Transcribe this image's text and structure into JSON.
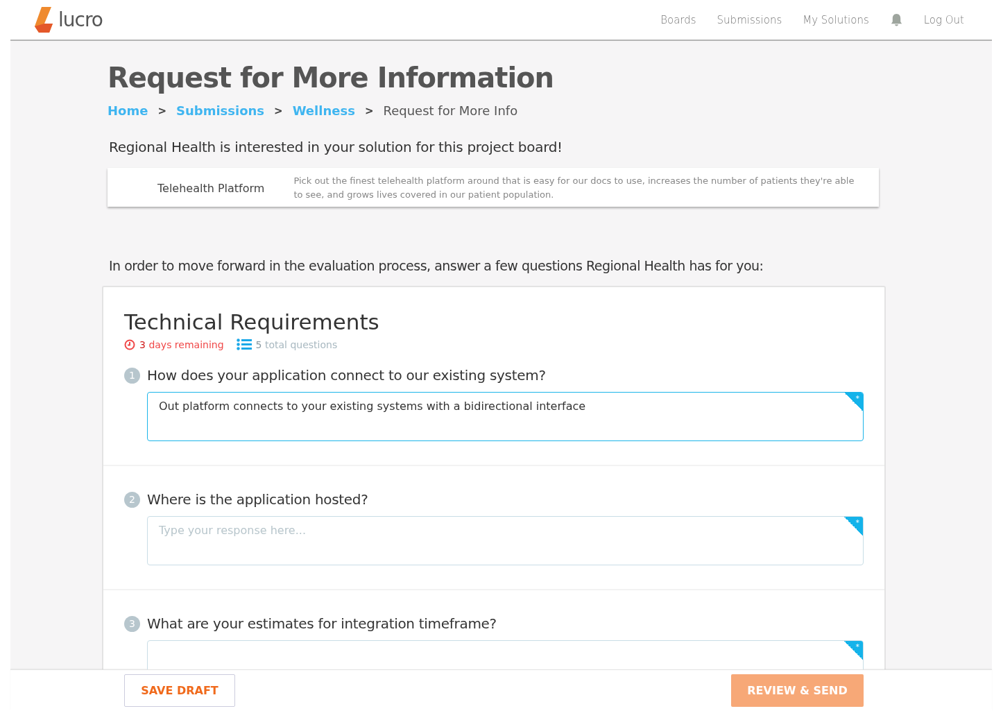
{
  "nav": {
    "brand": "lucro",
    "links": [
      {
        "label": "Boards"
      },
      {
        "label": "Submissions"
      },
      {
        "label": "My Solutions"
      }
    ],
    "logout": "Log Out"
  },
  "page_title": "Request for More Information",
  "breadcrumbs": [
    {
      "label": "Home",
      "link": true
    },
    {
      "label": "Submissions",
      "link": true
    },
    {
      "label": "Wellness",
      "link": true
    },
    {
      "label": "Request for More Info",
      "link": false
    }
  ],
  "breadcrumb_separator": ">",
  "intro": "Regional Health is interested in your solution for this project board!",
  "board": {
    "name": "Telehealth Platform",
    "description": "Pick out the finest telehealth platform around that is easy for our docs to use, increases the number of patients they're able to see, and grows lives covered in our patient population."
  },
  "prompt": "In order to move forward in the evaluation process, answer a few questions Regional Health has for you:",
  "section": {
    "title": "Technical Requirements",
    "days": "3",
    "days_label": "days remaining",
    "total": "5",
    "total_label": "total questions",
    "questions": [
      {
        "number": "1",
        "text": "How does your application connect to our existing system?",
        "value": "Out platform connects to your existing systems with a bidirectional interface",
        "focused": true,
        "required": true
      },
      {
        "number": "2",
        "text": "Where is the application hosted?",
        "placeholder": "Type your response here...",
        "focused": false,
        "required": true
      },
      {
        "number": "3",
        "text": "What are your estimates for integration timeframe?",
        "focused": false,
        "required": true
      }
    ]
  },
  "required_symbol": "*",
  "footer": {
    "save": "SAVE DRAFT",
    "send": "REVIEW & SEND"
  }
}
